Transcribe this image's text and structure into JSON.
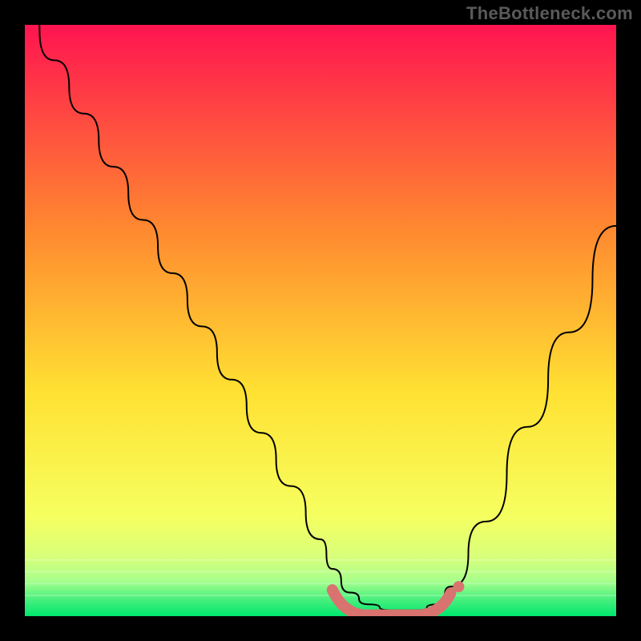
{
  "watermark": "TheBottleneck.com",
  "chart_data": {
    "type": "line",
    "title": "",
    "xlabel": "",
    "ylabel": "",
    "xlim": [
      0,
      100
    ],
    "ylim": [
      0,
      100
    ],
    "background_gradient": {
      "top": "#ff1450",
      "mid_upper": "#ff8730",
      "mid": "#ffe132",
      "mid_lower": "#f6ff60",
      "bottom": "#00e66e"
    },
    "series": [
      {
        "name": "bottleneck-curve",
        "type": "curve",
        "x": [
          0,
          5,
          10,
          15,
          20,
          25,
          30,
          35,
          40,
          45,
          50,
          52,
          55,
          58,
          62,
          66,
          70,
          72,
          78,
          85,
          92,
          100
        ],
        "y": [
          104,
          94,
          85,
          76,
          67,
          58,
          49,
          40,
          31,
          22,
          13,
          8,
          4,
          2,
          1,
          1,
          2,
          5,
          16,
          32,
          48,
          66
        ]
      },
      {
        "name": "bottom-marker-band",
        "type": "marker-band",
        "x_start": 52,
        "x_end": 72,
        "y": 2
      }
    ]
  }
}
